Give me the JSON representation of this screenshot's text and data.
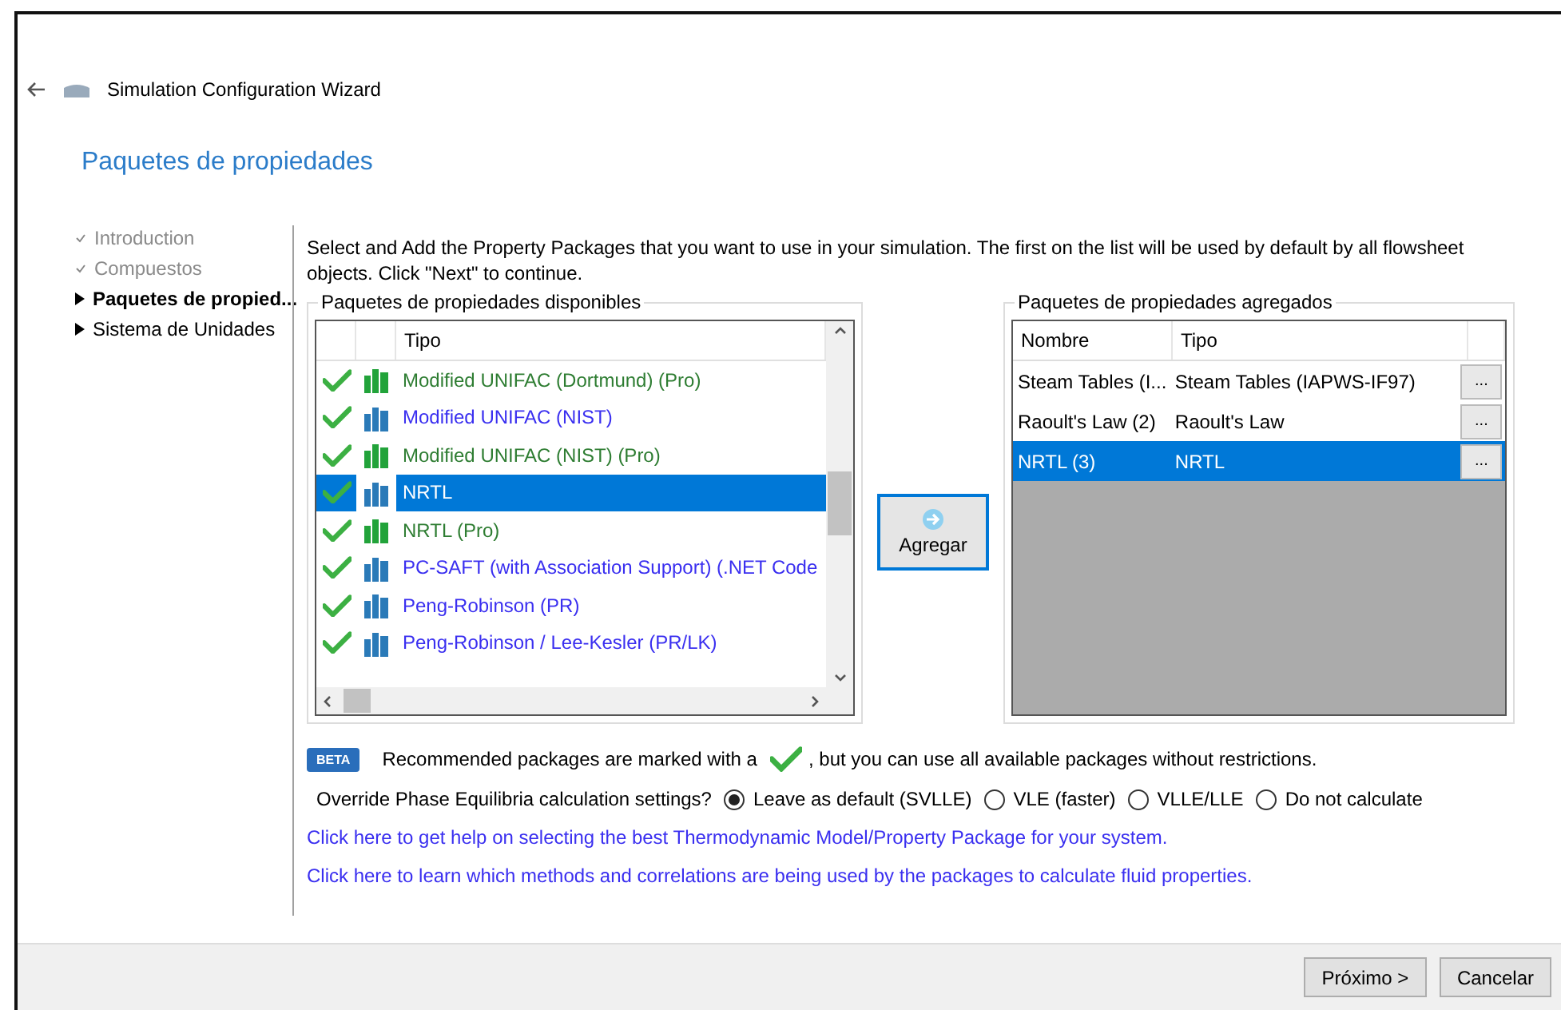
{
  "window": {
    "title": "Simulation Configuration Wizard"
  },
  "heading": "Paquetes de propiedades",
  "steps": [
    {
      "label": "Introduction",
      "kind": "done"
    },
    {
      "label": "Compuestos",
      "kind": "done"
    },
    {
      "label": "Paquetes de propied...",
      "kind": "current"
    },
    {
      "label": "Sistema de Unidades",
      "kind": "pending"
    }
  ],
  "description": "Select and Add the Property Packages that you want to use in your simulation. The first on the list will be used by default by all flowsheet objects. Click \"Next\" to continue.",
  "available": {
    "title": "Paquetes de propiedades disponibles",
    "column": "Tipo",
    "rows": [
      {
        "label": "Modified UNIFAC (Dortmund) (Pro)",
        "kind": "pro",
        "selected": false
      },
      {
        "label": "Modified UNIFAC (NIST)",
        "kind": "standard",
        "selected": false
      },
      {
        "label": "Modified UNIFAC (NIST) (Pro)",
        "kind": "pro",
        "selected": false
      },
      {
        "label": "NRTL",
        "kind": "standard",
        "selected": true
      },
      {
        "label": "NRTL (Pro)",
        "kind": "pro",
        "selected": false
      },
      {
        "label": "PC-SAFT (with Association Support) (.NET Code",
        "kind": "standard",
        "selected": false
      },
      {
        "label": "Peng-Robinson (PR)",
        "kind": "standard",
        "selected": false
      },
      {
        "label": "Peng-Robinson / Lee-Kesler (PR/LK)",
        "kind": "standard",
        "selected": false
      }
    ]
  },
  "add_button": "Agregar",
  "added": {
    "title": "Paquetes de propiedades agregados",
    "columns": [
      "Nombre",
      "Tipo"
    ],
    "rows": [
      {
        "name": "Steam Tables (I...",
        "type": "Steam Tables (IAPWS-IF97)",
        "button": "...",
        "selected": false
      },
      {
        "name": "Raoult's Law (2)",
        "type": "Raoult's Law",
        "button": "...",
        "selected": false
      },
      {
        "name": "NRTL (3)",
        "type": "NRTL",
        "button": "...",
        "selected": true
      }
    ]
  },
  "badge": "BETA",
  "recommend_before": "Recommended packages are marked with a",
  "recommend_after": ", but you can use all available packages without restrictions.",
  "override": {
    "label": "Override Phase Equilibria calculation settings?",
    "options": [
      {
        "label": "Leave as default (SVLLE)",
        "selected": true
      },
      {
        "label": "VLE (faster)",
        "selected": false
      },
      {
        "label": "VLLE/LLE",
        "selected": false
      },
      {
        "label": "Do not calculate",
        "selected": false
      }
    ]
  },
  "links": [
    "Click here to get help on selecting the best Thermodynamic Model/Property Package for your system.",
    "Click here to learn which methods and correlations are being used by the packages to calculate fluid properties."
  ],
  "buttons": [
    {
      "label": "Próximo >",
      "kind": "next"
    },
    {
      "label": "Cancelar",
      "kind": "cancel"
    }
  ]
}
